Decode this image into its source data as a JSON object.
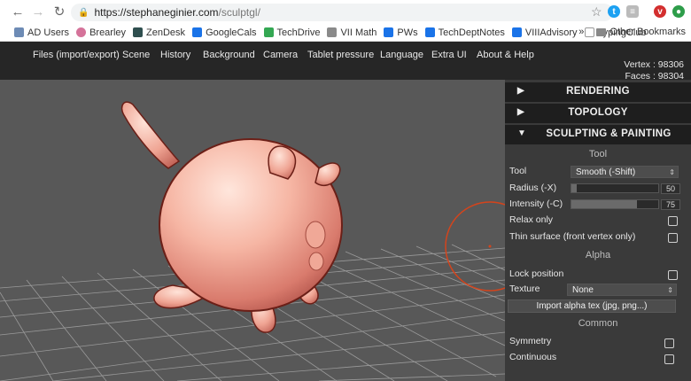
{
  "browser": {
    "url_host": "https://stephaneginier.com",
    "url_path": "/sculptgl/",
    "bookmarks": [
      {
        "label": "AD Users",
        "color": "#6d8bb5"
      },
      {
        "label": "Brearley",
        "color": "#d5739a"
      },
      {
        "label": "ZenDesk",
        "color": "#2f4f4f"
      },
      {
        "label": "GoogleCals",
        "color": "#1a73e8"
      },
      {
        "label": "TechDrive",
        "color": "#34a853"
      },
      {
        "label": "VII Math",
        "color": "#8a8a8a"
      },
      {
        "label": "PWs",
        "color": "#1a73e8"
      },
      {
        "label": "TechDeptNotes",
        "color": "#1a73e8"
      },
      {
        "label": "VIIIAdvisory",
        "color": "#1a73e8"
      },
      {
        "label": "TypingClub",
        "color": "#999999"
      }
    ],
    "more_bookmarks": "»",
    "other_bookmarks": "Other Bookmarks"
  },
  "menu": {
    "items": [
      "Files (import/export)",
      "Scene",
      "History",
      "Background",
      "Camera",
      "Tablet pressure",
      "Language",
      "Extra UI",
      "About & Help"
    ],
    "vertex": "Vertex : 98306",
    "faces": "Faces : 98304"
  },
  "panel": {
    "rendering": "RENDERING",
    "topology": "TOPOLOGY",
    "sculpting": "SCULPTING & PAINTING",
    "tool_header": "Tool",
    "tool_label": "Tool",
    "tool_value": "Smooth (-Shift)",
    "radius_label": "Radius (-X)",
    "radius_value": "50",
    "radius_fraction": 0.06,
    "intensity_label": "Intensity (-C)",
    "intensity_value": "75",
    "intensity_fraction": 0.75,
    "relax_label": "Relax only",
    "thin_label": "Thin surface (front vertex only)",
    "alpha_header": "Alpha",
    "lock_label": "Lock position",
    "texture_label": "Texture",
    "texture_value": "None",
    "import_label": "Import alpha tex (jpg, png...)",
    "common_header": "Common",
    "symmetry_label": "Symmetry",
    "continuous_label": "Continuous"
  }
}
